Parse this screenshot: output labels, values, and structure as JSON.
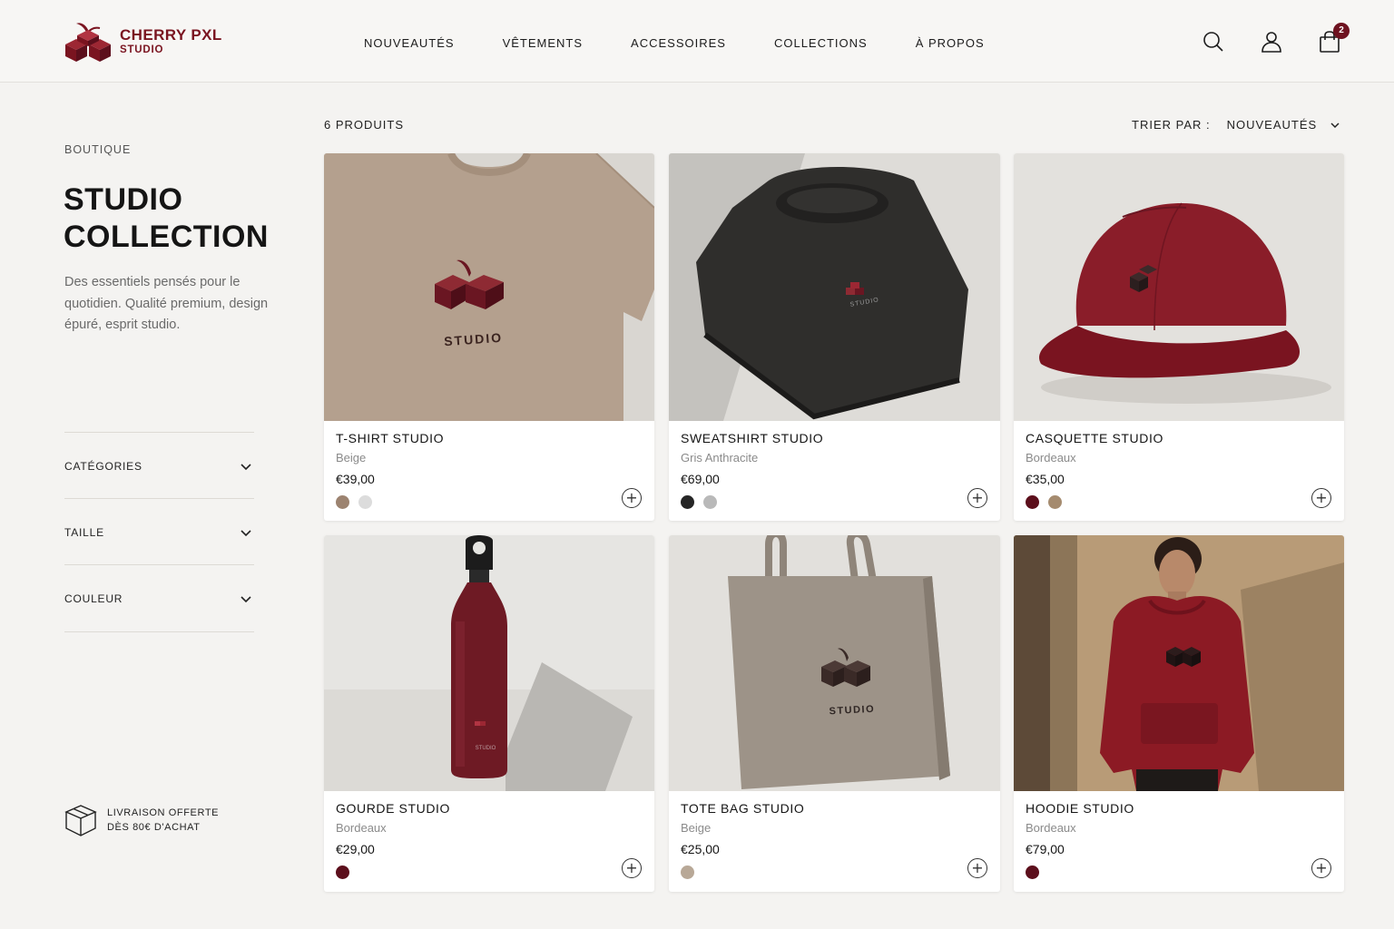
{
  "brand": {
    "name_line1": "CHERRY PXL",
    "name_line2": "STUDIO",
    "color": "#7a1420"
  },
  "nav": {
    "items": [
      {
        "label": "NOUVEAUTÉS"
      },
      {
        "label": "VÊTEMENTS"
      },
      {
        "label": "ACCESSOIRES"
      },
      {
        "label": "COLLECTIONS"
      },
      {
        "label": "À PROPOS"
      }
    ]
  },
  "header_icons": {
    "search": "search-icon",
    "account": "user-icon",
    "cart": "shopping-bag-icon",
    "cart_count": "2"
  },
  "sidebar": {
    "eyebrow": "BOUTIQUE",
    "title_line1": "STUDIO",
    "title_line2": "COLLECTION",
    "description": "Des essentiels pensés pour le quotidien. Qualité premium, design épuré, esprit studio.",
    "filters": [
      {
        "label": "CATÉGORIES"
      },
      {
        "label": "TAILLE"
      },
      {
        "label": "COULEUR"
      }
    ],
    "shipping_line1": "LIVRAISON OFFERTE",
    "shipping_line2": "DÈS 80€ D'ACHAT"
  },
  "toolbar": {
    "count": "6 PRODUITS",
    "sort_label": "TRIER PAR :",
    "sort_value": "NOUVEAUTÉS"
  },
  "products": [
    {
      "name": "T-SHIRT STUDIO",
      "color": "Beige",
      "price": "€39,00",
      "swatches": [
        "#9c8370",
        "#dcdcdc"
      ]
    },
    {
      "name": "SWEATSHIRT STUDIO",
      "color": "Gris Anthracite",
      "price": "€69,00",
      "swatches": [
        "#262626",
        "#b9b9b9"
      ]
    },
    {
      "name": "CASQUETTE STUDIO",
      "color": "Bordeaux",
      "price": "€35,00",
      "swatches": [
        "#5c0f1c",
        "#a58b6f"
      ]
    },
    {
      "name": "GOURDE STUDIO",
      "color": "Bordeaux",
      "price": "€29,00",
      "swatches": [
        "#5c0f1c"
      ]
    },
    {
      "name": "TOTE BAG STUDIO",
      "color": "Beige",
      "price": "€25,00",
      "swatches": [
        "#b8a897"
      ]
    },
    {
      "name": "HOODIE STUDIO",
      "color": "Bordeaux",
      "price": "€79,00",
      "swatches": [
        "#5c0f1c"
      ]
    }
  ],
  "print_label": "STUDIO"
}
